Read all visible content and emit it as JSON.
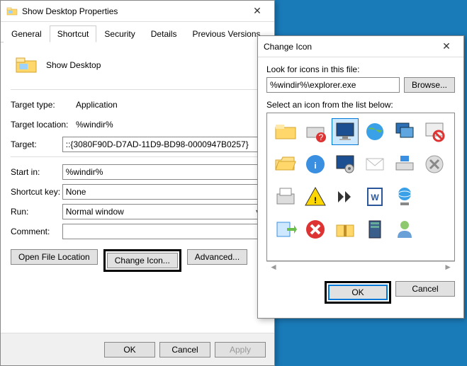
{
  "properties": {
    "title": "Show Desktop Properties",
    "tabs": [
      "General",
      "Shortcut",
      "Security",
      "Details",
      "Previous Versions"
    ],
    "active_tab": 1,
    "name": "Show Desktop",
    "fields": {
      "target_type_label": "Target type:",
      "target_type_value": "Application",
      "target_location_label": "Target location:",
      "target_location_value": "%windir%",
      "target_label": "Target:",
      "target_value": "::{3080F90D-D7AD-11D9-BD98-0000947B0257}",
      "start_in_label": "Start in:",
      "start_in_value": "%windir%",
      "shortcut_key_label": "Shortcut key:",
      "shortcut_key_value": "None",
      "run_label": "Run:",
      "run_value": "Normal window",
      "comment_label": "Comment:",
      "comment_value": ""
    },
    "buttons": {
      "open_file_location": "Open File Location",
      "change_icon": "Change Icon...",
      "advanced": "Advanced..."
    },
    "footer": {
      "ok": "OK",
      "cancel": "Cancel",
      "apply": "Apply"
    }
  },
  "change_icon": {
    "title": "Change Icon",
    "look_label": "Look for icons in this file:",
    "path_value": "%windir%\\explorer.exe",
    "browse": "Browse...",
    "select_label": "Select an icon from the list below:",
    "footer": {
      "ok": "OK",
      "cancel": "Cancel"
    }
  }
}
